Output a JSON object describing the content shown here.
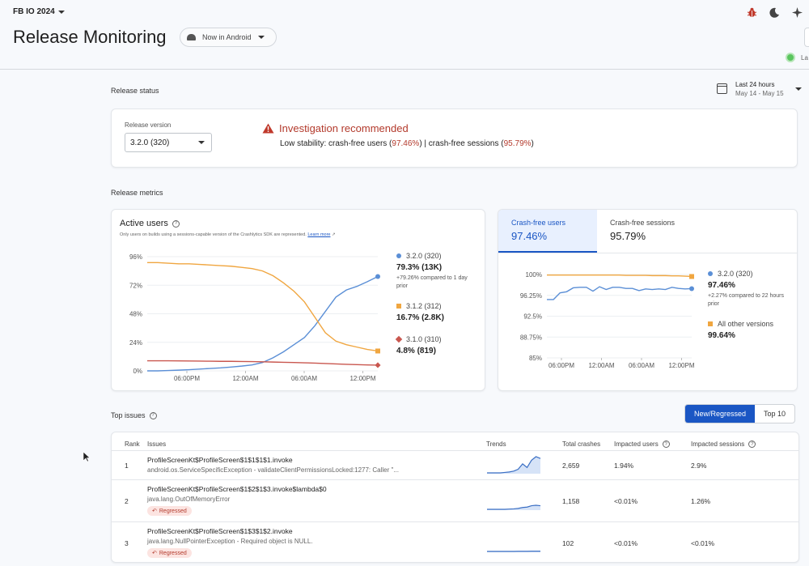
{
  "header": {
    "project": "FB IO 2024",
    "title": "Release Monitoring",
    "app": "Now in Android",
    "live_label": "La",
    "icons": [
      "bug-icon",
      "dark-mode-icon",
      "sparkle-icon"
    ]
  },
  "release_status": {
    "section": "Release status",
    "date_range": {
      "label": "Last 24 hours",
      "range": "May 14 - May 15"
    },
    "version_label": "Release version",
    "version_value": "3.2.0 (320)",
    "warning_title": "Investigation recommended",
    "warning_prefix": "Low stability: crash-free users (",
    "users_pct": "97.46%",
    "warning_mid": ") | crash-free sessions (",
    "sessions_pct": "95.79%",
    "warning_suffix": ")"
  },
  "release_metrics": {
    "section": "Release metrics",
    "active_users": {
      "title": "Active users",
      "note": "Only users on builds using a sessions-capable version of the Crashlytics SDK are represented.",
      "learn_more": "Learn more",
      "legend": [
        {
          "name": "3.2.0 (320)",
          "value": "79.3% (13K)",
          "sub": "+79.26% compared to 1 day prior",
          "color": "#5b8fd6"
        },
        {
          "name": "3.1.2 (312)",
          "value": "16.7% (2.8K)",
          "sub": "",
          "color": "#f0a640"
        },
        {
          "name": "3.1.0 (310)",
          "value": "4.8% (819)",
          "sub": "",
          "color": "#c9574f"
        }
      ]
    },
    "crash_free": {
      "tabs": [
        {
          "label": "Crash-free users",
          "value": "97.46%"
        },
        {
          "label": "Crash-free sessions",
          "value": "95.79%"
        }
      ],
      "legend": [
        {
          "name": "3.2.0 (320)",
          "value": "97.46%",
          "sub": "+2.27% compared to 22 hours prior",
          "color": "#5b8fd6"
        },
        {
          "name": "All other versions",
          "value": "99.64%",
          "sub": "",
          "color": "#f0a640"
        }
      ]
    }
  },
  "chart_data": [
    {
      "type": "line",
      "title": "Active users",
      "x_ticks": [
        "06:00PM",
        "12:00AM",
        "06:00AM",
        "12:00PM"
      ],
      "y_ticks": [
        "0%",
        "24%",
        "48%",
        "72%",
        "96%"
      ],
      "ylim": [
        0,
        96
      ],
      "x": [
        0,
        1,
        2,
        3,
        4,
        5,
        6,
        7,
        8,
        9,
        10,
        11,
        12,
        13,
        14,
        15,
        16,
        17,
        18,
        19,
        20,
        21,
        22
      ],
      "series": [
        {
          "name": "3.2.0 (320)",
          "color": "#5b8fd6",
          "values": [
            0,
            0,
            0.3,
            0.6,
            1,
            1.5,
            2,
            2.5,
            3.2,
            4,
            5,
            7,
            11,
            16,
            22,
            28,
            38,
            50,
            62,
            68,
            71,
            75,
            79.3
          ]
        },
        {
          "name": "3.1.2 (312)",
          "color": "#f0a640",
          "values": [
            91,
            91,
            90.5,
            90,
            90,
            89.5,
            89,
            88.5,
            88,
            87,
            86,
            84,
            80,
            74,
            67,
            58,
            45,
            32,
            25,
            22,
            20,
            18,
            16.7
          ]
        },
        {
          "name": "3.1.0 (310)",
          "color": "#c9574f",
          "values": [
            8.5,
            8.5,
            8.5,
            8.4,
            8.3,
            8.2,
            8.1,
            8,
            8,
            7.9,
            7.8,
            7.6,
            7.4,
            7.2,
            7,
            6.8,
            6.5,
            6.2,
            5.8,
            5.5,
            5.2,
            5,
            4.8
          ]
        }
      ]
    },
    {
      "type": "line",
      "title": "Crash-free users",
      "x_ticks": [
        "06:00PM",
        "12:00AM",
        "06:00AM",
        "12:00PM"
      ],
      "y_ticks": [
        "85%",
        "88.75%",
        "92.5%",
        "96.25%",
        "100%"
      ],
      "ylim": [
        85,
        100
      ],
      "x": [
        0,
        1,
        2,
        3,
        4,
        5,
        6,
        7,
        8,
        9,
        10,
        11,
        12,
        13,
        14,
        15,
        16,
        17,
        18,
        19,
        20,
        21,
        22
      ],
      "series": [
        {
          "name": "3.2.0 (320)",
          "color": "#5b8fd6",
          "values": [
            95.5,
            95.5,
            96.7,
            96.9,
            97.6,
            97.7,
            97.7,
            97.0,
            97.8,
            97.3,
            97.7,
            97.7,
            97.5,
            97.5,
            97.1,
            97.4,
            97.3,
            97.4,
            97.3,
            97.7,
            97.5,
            97.4,
            97.46
          ]
        },
        {
          "name": "All other versions",
          "color": "#f0a640",
          "values": [
            99.9,
            99.9,
            99.9,
            99.9,
            99.9,
            99.9,
            99.9,
            99.9,
            99.9,
            99.9,
            99.9,
            99.9,
            99.85,
            99.85,
            99.85,
            99.85,
            99.8,
            99.8,
            99.8,
            99.75,
            99.75,
            99.7,
            99.64
          ]
        }
      ]
    }
  ],
  "top_issues": {
    "section": "Top issues",
    "toggle": [
      "New/Regressed",
      "Top 10"
    ],
    "columns": [
      "Rank",
      "Issues",
      "Trends",
      "Total crashes",
      "Impacted users",
      "Impacted sessions"
    ],
    "rows": [
      {
        "rank": "1",
        "title": "ProfileScreenKt$ProfileScreen$1$1$1$1.invoke",
        "subtitle": "android.os.ServiceSpecificException - validateClientPermissionsLocked:1277: Caller \"...",
        "badge": "",
        "crashes": "2,659",
        "users": "1.94%",
        "sessions": "2.9%",
        "trend": [
          0,
          0,
          0,
          0,
          0.5,
          1,
          2,
          4,
          10,
          6,
          14,
          18,
          16
        ]
      },
      {
        "rank": "2",
        "title": "ProfileScreenKt$ProfileScreen$1$2$1$3.invoke$lambda$0",
        "subtitle": "java.lang.OutOfMemoryError",
        "badge": "Regressed",
        "crashes": "1,158",
        "users": "<0.01%",
        "sessions": "1.26%",
        "trend": [
          0,
          0,
          0,
          0,
          0,
          0.3,
          0.5,
          1,
          2,
          2.5,
          4,
          4.5,
          4
        ]
      },
      {
        "rank": "3",
        "title": "ProfileScreenKt$ProfileScreen$1$3$1$2.invoke",
        "subtitle": "java.lang.NullPointerException - Required object is NULL.",
        "badge": "Regressed",
        "crashes": "102",
        "users": "<0.01%",
        "sessions": "<0.01%",
        "trend": [
          0,
          0,
          0,
          0,
          0,
          0,
          0,
          0.1,
          0.1,
          0.1,
          0.2,
          0.2,
          0.2
        ]
      }
    ]
  }
}
